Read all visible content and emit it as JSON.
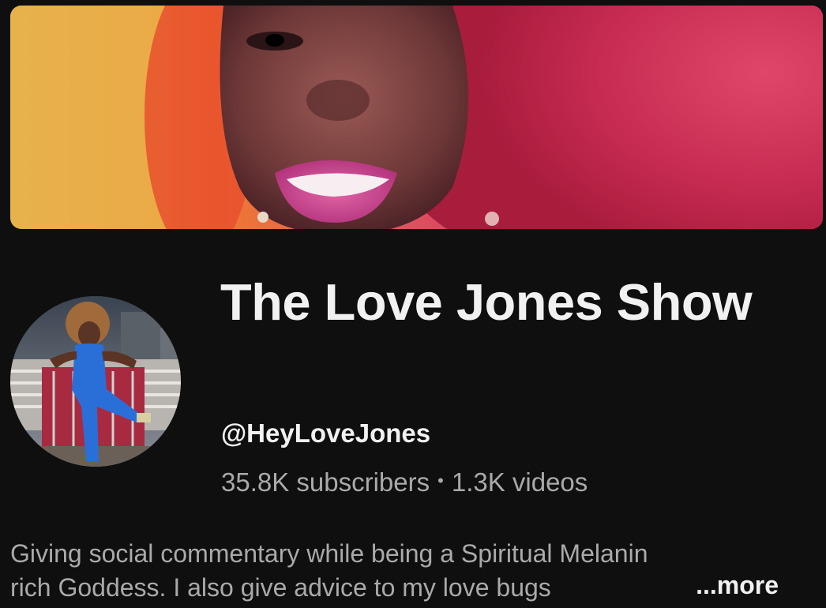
{
  "channel": {
    "name": "The Love Jones Show",
    "handle": "@HeyLoveJones",
    "subscribers": "35.8K subscribers",
    "separator": "•",
    "videos": "1.3K videos"
  },
  "description": {
    "line1": "Giving social commentary while being a Spiritual Melanin",
    "line2": "rich Goddess. I also give advice to my love bugs",
    "more_label": "...more"
  },
  "colors": {
    "background": "#0f0f0f",
    "primary_text": "#f1f1f1",
    "secondary_text": "#aaaaaa"
  }
}
